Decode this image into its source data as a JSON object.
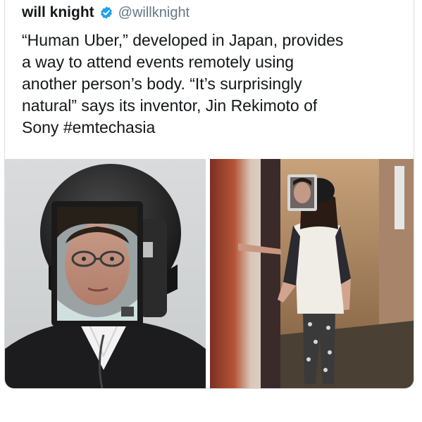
{
  "tweet": {
    "display_name": "will knight",
    "verified_icon": "verified-badge-icon",
    "handle": "@willknight",
    "text_lines": [
      "“Human Uber,” developed in Japan, provides",
      "a way to attend events remotely using",
      "another person’s body. “It’s surprisingly",
      "natural” says its inventor, Jin Rekimoto of"
    ],
    "last_line_prefix": "Sony ",
    "hashtag": "#emtechasia"
  },
  "media": [
    {
      "name": "photo-helmet-tablet-closeup",
      "description_icon": "photo"
    },
    {
      "name": "photo-person-wearing-tablet",
      "description_icon": "photo"
    }
  ],
  "colors": {
    "text": "#14171a",
    "handle": "#657786",
    "verified": "#1da1f2",
    "border": "#d9dee3"
  }
}
